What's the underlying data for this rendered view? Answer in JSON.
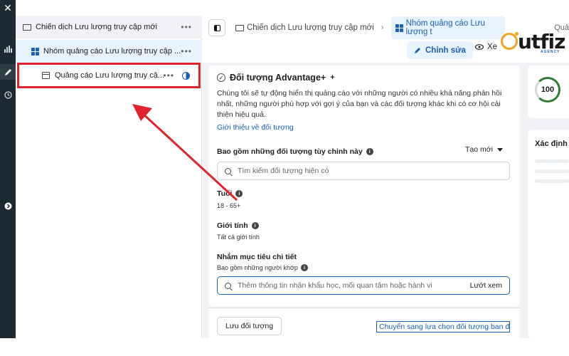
{
  "rail": {
    "close_icon": "close-icon",
    "icons": [
      "bar-chart-icon",
      "pencil-icon",
      "clock-icon",
      "chevron-right-icon"
    ]
  },
  "tree": {
    "campaign": {
      "label": "Chiến dịch Lưu lượng truy cập mới",
      "more": "•••"
    },
    "adset": {
      "label": "Nhóm quảng cáo Lưu lượng truy cập ...",
      "more": "•••"
    },
    "ad": {
      "label": "Quảng cáo Lưu lượng truy cậ...",
      "more": "•••"
    }
  },
  "breadcrumb": {
    "campaign": "Chiến dịch Lưu lượng truy cập mới",
    "adset": "Nhóm quảng cáo Lưu lượng t",
    "overflow": "Quả"
  },
  "actions": {
    "edit": "Chỉnh sửa",
    "view": "Xe"
  },
  "audience": {
    "title": "Đối tượng Advantage+",
    "description": "Chúng tôi sẽ tự động hiển thị quảng cáo với những người có nhiều khả năng phản hồi nhất, những người phù hợp với gợi ý của bạn và các đối tượng khác khi có cơ hội cải thiện hiệu quả.",
    "intro_link": "Giới thiệu về đối tượng",
    "custom_label": "Bao gồm những đối tượng tùy chỉnh này",
    "create_new": "Tạo mới",
    "custom_search_placeholder": "Tìm kiếm đối tượng hiện có",
    "age_label": "Tuổi",
    "age_value": "18 - 65+",
    "gender_label": "Giới tính",
    "gender_value": "Tất cả giới tính",
    "detail_label": "Nhắm mục tiêu chi tiết",
    "detail_sub": "Bao gồm những người khớp",
    "detail_placeholder": "Thêm thông tin nhân khẩu học, mối quan tâm hoặc hành vi",
    "browse": "Lướt xem"
  },
  "footer": {
    "save": "Lưu đối tượng",
    "switch": "Chuyển sang lựa chọn đối tượng ban đầu"
  },
  "right": {
    "score": "100",
    "heading": "Xác định"
  },
  "logo": {
    "text": "utfiz",
    "sub": "AGENCY"
  },
  "colors": {
    "accent": "#1a5fb4",
    "highlight": "#e0242b",
    "logo": "#f7a21b"
  }
}
